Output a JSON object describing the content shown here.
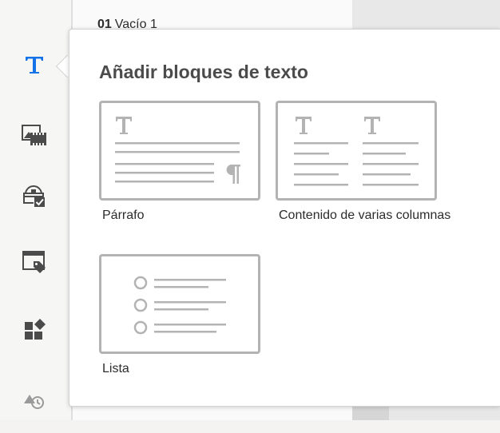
{
  "document": {
    "number": "01",
    "title": "Vacío 1"
  },
  "rail": {
    "items": [
      {
        "name": "text-blocks",
        "icon": "text-t-icon",
        "active": true
      },
      {
        "name": "media-blocks",
        "icon": "image-video-icon"
      },
      {
        "name": "approval-blocks",
        "icon": "stamp-check-icon"
      },
      {
        "name": "offer-blocks",
        "icon": "window-tag-icon"
      },
      {
        "name": "component-blocks",
        "icon": "grid-diamond-icon"
      },
      {
        "name": "shapes-history",
        "icon": "shapes-history-icon"
      }
    ]
  },
  "popover": {
    "title": "Añadir bloques de texto",
    "blocks": [
      {
        "label": "Párrafo",
        "icon": "paragraph-block-icon"
      },
      {
        "label": "Contenido de varias columnas",
        "icon": "multi-column-block-icon"
      },
      {
        "label": "Lista",
        "icon": "list-block-icon"
      }
    ]
  },
  "colors": {
    "accent": "#1473e6",
    "icon": "#4b4b4b",
    "thumb_stroke": "#b3b3b3"
  }
}
